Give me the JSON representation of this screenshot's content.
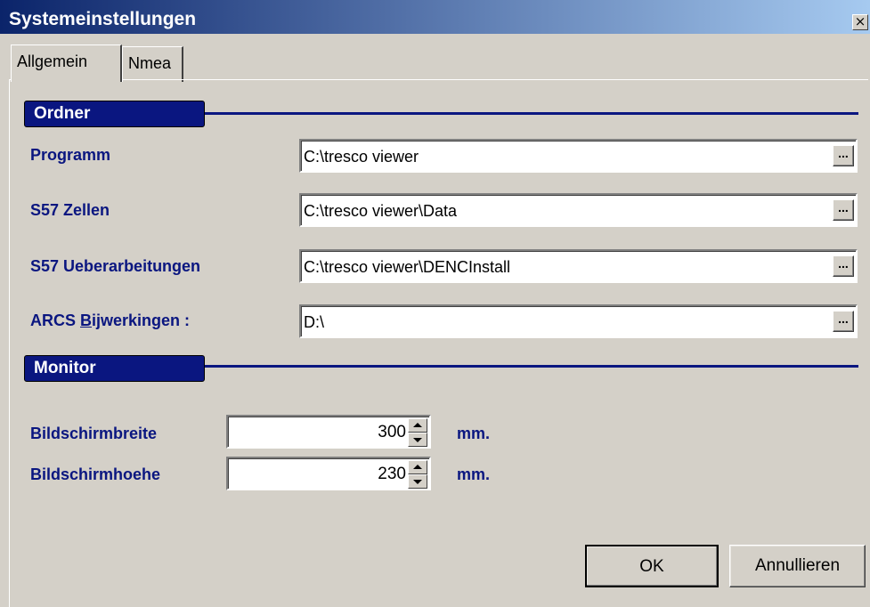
{
  "window": {
    "title": "Systemeinstellungen",
    "close_symbol": "×"
  },
  "tabs": [
    {
      "label": "Allgemein",
      "selected": true
    },
    {
      "label": "Nmea",
      "selected": false
    }
  ],
  "sections": {
    "ordner": {
      "title": "Ordner",
      "fields": [
        {
          "label": "Programm",
          "value": "C:\\tresco viewer"
        },
        {
          "label": "S57 Zellen",
          "value": "C:\\tresco viewer\\Data"
        },
        {
          "label": "S57 Ueberarbeitungen",
          "value": "C:\\tresco viewer\\DENCInstall"
        },
        {
          "label_prefix": "ARCS ",
          "label_underlined": "B",
          "label_rest": "ijwerkingen :",
          "value": "D:\\"
        }
      ],
      "browse_label": "..."
    },
    "monitor": {
      "title": "Monitor",
      "fields": [
        {
          "label": "Bildschirmbreite",
          "value": "300",
          "unit": "mm."
        },
        {
          "label": "Bildschirmhoehe",
          "value": "230",
          "unit": "mm."
        }
      ]
    }
  },
  "buttons": {
    "ok": "OK",
    "cancel": "Annullieren"
  },
  "colors": {
    "titlebar_start": "#0b246a",
    "titlebar_end": "#a6caf0",
    "label": "#0a1680",
    "face": "#d4d0c8"
  }
}
